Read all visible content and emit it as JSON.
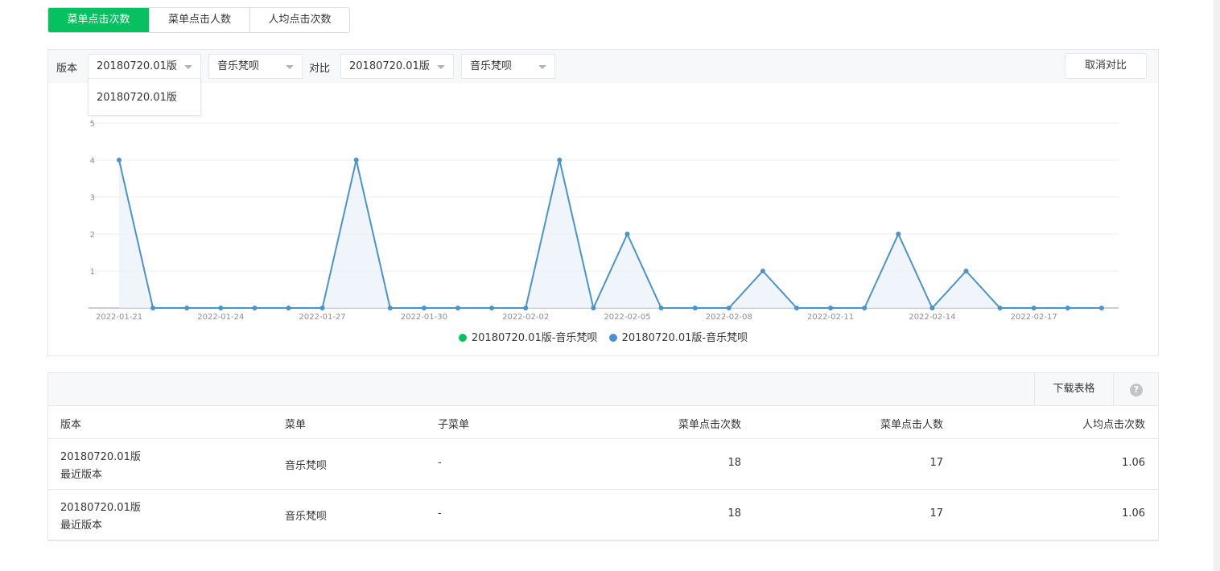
{
  "tabs": [
    {
      "label": "菜单点击次数",
      "active": true
    },
    {
      "label": "菜单点击人数",
      "active": false
    },
    {
      "label": "人均点击次数",
      "active": false
    }
  ],
  "filters": {
    "version_label": "版本",
    "version_value": "20180720.01版",
    "menu_value": "音乐梵呗",
    "compare_label": "对比",
    "compare_version_value": "20180720.01版",
    "compare_menu_value": "音乐梵呗",
    "cancel_compare": "取消对比",
    "dropdown_options": [
      "20180720.01版"
    ]
  },
  "chart_data": {
    "type": "area",
    "y_ticks": [
      "1",
      "2",
      "3",
      "4",
      "5"
    ],
    "ylim": [
      0,
      5
    ],
    "x": [
      "2022-01-21",
      "2022-01-22",
      "2022-01-23",
      "2022-01-24",
      "2022-01-25",
      "2022-01-26",
      "2022-01-27",
      "2022-01-28",
      "2022-01-29",
      "2022-01-30",
      "2022-01-31",
      "2022-02-01",
      "2022-02-02",
      "2022-02-03",
      "2022-02-04",
      "2022-02-05",
      "2022-02-06",
      "2022-02-07",
      "2022-02-08",
      "2022-02-09",
      "2022-02-10",
      "2022-02-11",
      "2022-02-12",
      "2022-02-13",
      "2022-02-14",
      "2022-02-15",
      "2022-02-16",
      "2022-02-17",
      "2022-02-18",
      "2022-02-19"
    ],
    "x_tick_labels": [
      "2022-01-21",
      "2022-01-24",
      "2022-01-27",
      "2022-01-30",
      "2022-02-02",
      "2022-02-05",
      "2022-02-08",
      "2022-02-11",
      "2022-02-14",
      "2022-02-17"
    ],
    "series": [
      {
        "name": "20180720.01版-音乐梵呗",
        "color": "#07c160",
        "values": [
          4,
          0,
          0,
          0,
          0,
          0,
          0,
          4,
          0,
          0,
          0,
          0,
          0,
          4,
          0,
          2,
          0,
          0,
          0,
          1,
          0,
          0,
          0,
          2,
          0,
          1,
          0,
          0,
          0,
          0
        ]
      },
      {
        "name": "20180720.01版-音乐梵呗",
        "color": "#4a90d9",
        "values": [
          4,
          0,
          0,
          0,
          0,
          0,
          0,
          4,
          0,
          0,
          0,
          0,
          0,
          4,
          0,
          2,
          0,
          0,
          0,
          1,
          0,
          0,
          0,
          2,
          0,
          1,
          0,
          0,
          0,
          0
        ]
      }
    ],
    "line_color": "#4c94c8",
    "grid": true
  },
  "table": {
    "download_label": "下载表格",
    "help_icon": "?",
    "headers": [
      "版本",
      "菜单",
      "子菜单",
      "菜单点击次数",
      "菜单点击人数",
      "人均点击次数"
    ],
    "rows": [
      {
        "version": "20180720.01版",
        "version_note": "最近版本",
        "menu": "音乐梵呗",
        "submenu": "-",
        "clicks": "18",
        "users": "17",
        "avg": "1.06"
      },
      {
        "version": "20180720.01版",
        "version_note": "最近版本",
        "menu": "音乐梵呗",
        "submenu": "-",
        "clicks": "18",
        "users": "17",
        "avg": "1.06"
      }
    ]
  }
}
